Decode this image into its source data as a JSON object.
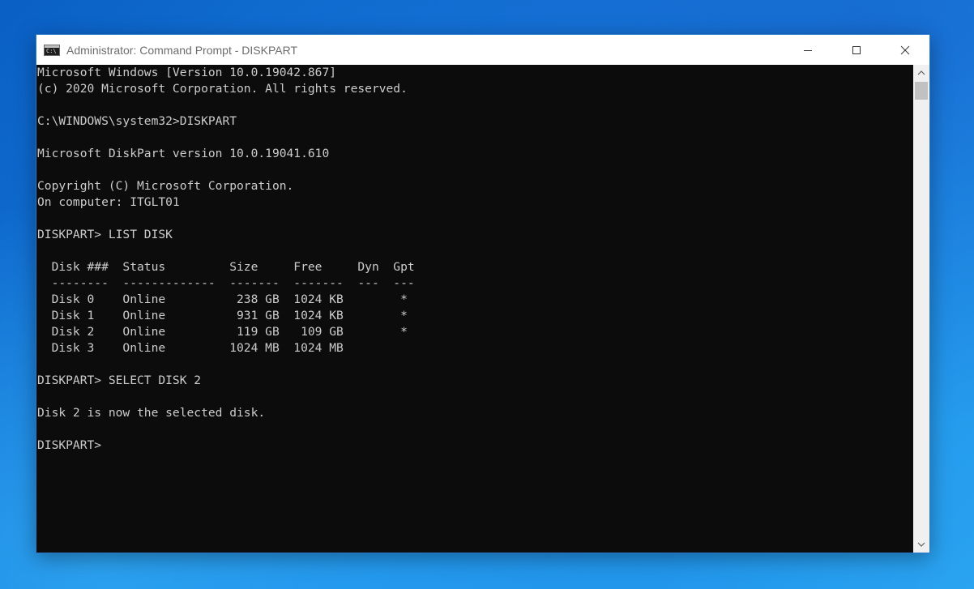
{
  "window": {
    "title": "Administrator: Command Prompt - DISKPART",
    "app_icon_text": "C:\\"
  },
  "caption_buttons": {
    "minimize": "minimize-icon",
    "maximize": "maximize-icon",
    "close": "close-icon"
  },
  "console": {
    "lines": [
      "Microsoft Windows [Version 10.0.19042.867]",
      "(c) 2020 Microsoft Corporation. All rights reserved.",
      "",
      "C:\\WINDOWS\\system32>DISKPART",
      "",
      "Microsoft DiskPart version 10.0.19041.610",
      "",
      "Copyright (C) Microsoft Corporation.",
      "On computer: ITGLT01",
      "",
      "DISKPART> LIST DISK",
      "",
      "  Disk ###  Status         Size     Free     Dyn  Gpt",
      "  --------  -------------  -------  -------  ---  ---",
      "  Disk 0    Online          238 GB  1024 KB        *",
      "  Disk 1    Online          931 GB  1024 KB        *",
      "  Disk 2    Online          119 GB   109 GB        *",
      "  Disk 3    Online         1024 MB  1024 MB",
      "",
      "DISKPART> SELECT DISK 2",
      "",
      "Disk 2 is now the selected disk.",
      "",
      "DISKPART> "
    ]
  },
  "colors": {
    "console_bg": "#0c0c0c",
    "console_fg": "#cccccc",
    "titlebar_bg": "#ffffff",
    "window_border": "#2b79c9"
  }
}
